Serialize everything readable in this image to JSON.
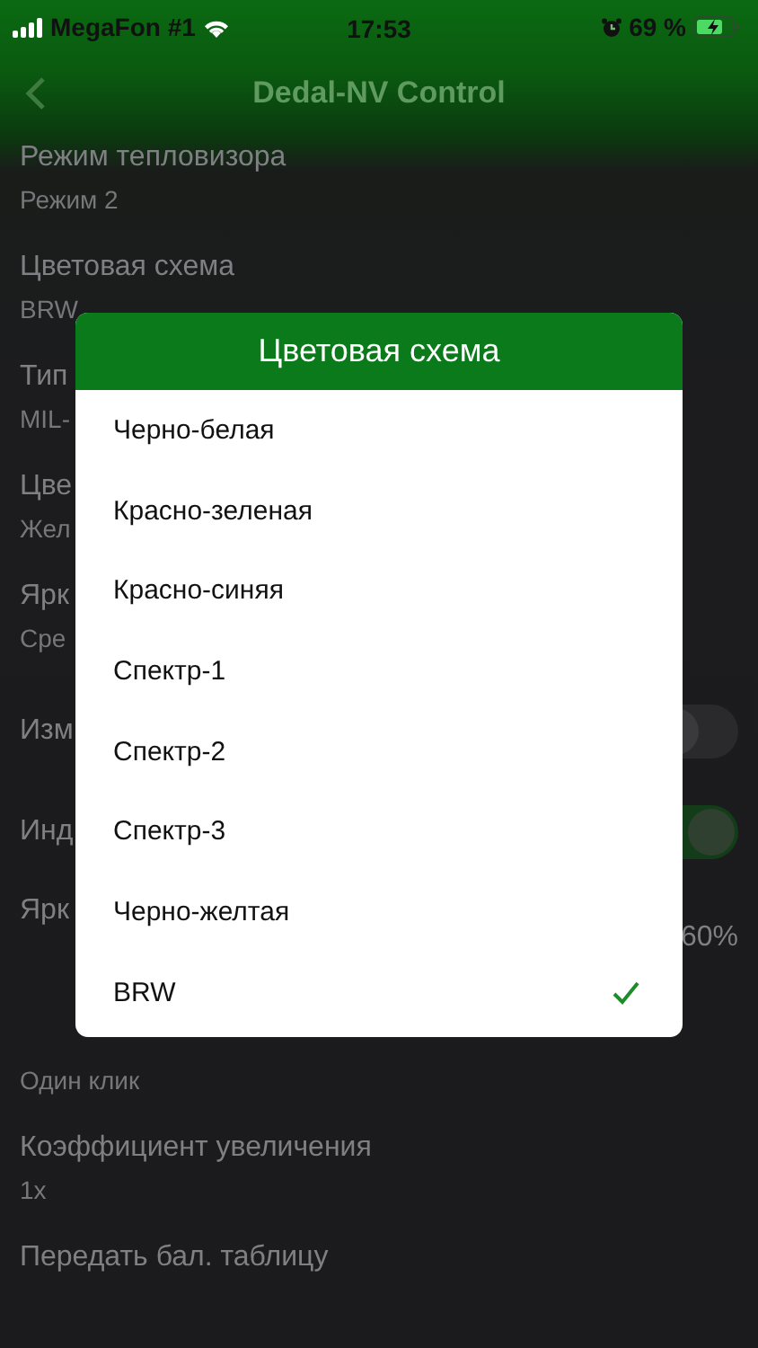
{
  "status_bar": {
    "carrier": "MegaFon #1",
    "time": "17:53",
    "battery": "69 %"
  },
  "nav": {
    "title": "Dedal-NV Control"
  },
  "settings": [
    {
      "kind": "text",
      "label": "Режим тепловизора",
      "value": "Режим 2"
    },
    {
      "kind": "text",
      "label": "Цветовая схема",
      "value": "BRW"
    },
    {
      "kind": "text",
      "label": "Тип",
      "value": "MIL-"
    },
    {
      "kind": "text",
      "label": "Цве",
      "value": "Жел"
    },
    {
      "kind": "text",
      "label": "Ярк",
      "value": "Сре"
    },
    {
      "kind": "switch",
      "label": "Изм",
      "on": false
    },
    {
      "kind": "switch",
      "label": "Инд",
      "on": true
    },
    {
      "kind": "reading",
      "label": "Ярк",
      "reading": "60%"
    },
    {
      "kind": "text",
      "value": "Один клик"
    },
    {
      "kind": "text",
      "label": "Коэффициент увеличения",
      "value": "1x"
    },
    {
      "kind": "action",
      "label": "Передать бал. таблицу"
    }
  ],
  "dialog": {
    "title": "Цветовая схема",
    "options": [
      {
        "label": "Черно-белая",
        "selected": false
      },
      {
        "label": "Красно-зеленая",
        "selected": false
      },
      {
        "label": "Красно-синяя",
        "selected": false
      },
      {
        "label": "Спектр-1",
        "selected": false
      },
      {
        "label": "Спектр-2",
        "selected": false
      },
      {
        "label": "Спектр-3",
        "selected": false
      },
      {
        "label": "Черно-желтая",
        "selected": false
      },
      {
        "label": "BRW",
        "selected": true
      }
    ]
  }
}
